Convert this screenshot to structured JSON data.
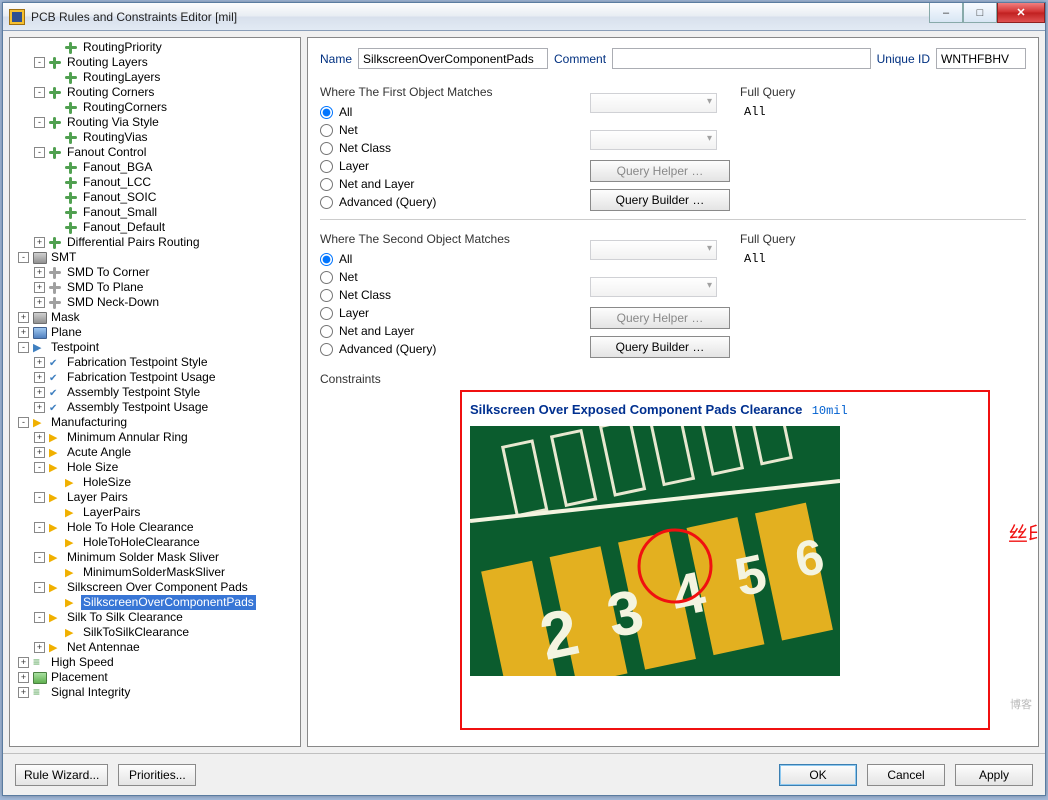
{
  "window": {
    "title": "PCB Rules and Constraints Editor [mil]"
  },
  "tree": {
    "nodes": [
      {
        "lbl": "RoutingPriority",
        "ic": "route",
        "depth": 3
      },
      {
        "lbl": "Routing Layers",
        "ic": "route",
        "depth": 2,
        "exp": "-"
      },
      {
        "lbl": "RoutingLayers",
        "ic": "route",
        "depth": 3
      },
      {
        "lbl": "Routing Corners",
        "ic": "route",
        "depth": 2,
        "exp": "-"
      },
      {
        "lbl": "RoutingCorners",
        "ic": "route",
        "depth": 3
      },
      {
        "lbl": "Routing Via Style",
        "ic": "route",
        "depth": 2,
        "exp": "-"
      },
      {
        "lbl": "RoutingVias",
        "ic": "route",
        "depth": 3
      },
      {
        "lbl": "Fanout Control",
        "ic": "route",
        "depth": 2,
        "exp": "-"
      },
      {
        "lbl": "Fanout_BGA",
        "ic": "route",
        "depth": 3
      },
      {
        "lbl": "Fanout_LCC",
        "ic": "route",
        "depth": 3
      },
      {
        "lbl": "Fanout_SOIC",
        "ic": "route",
        "depth": 3
      },
      {
        "lbl": "Fanout_Small",
        "ic": "route",
        "depth": 3
      },
      {
        "lbl": "Fanout_Default",
        "ic": "route",
        "depth": 3
      },
      {
        "lbl": "Differential Pairs Routing",
        "ic": "route",
        "depth": 2,
        "exp": "+"
      },
      {
        "lbl": "SMT",
        "ic": "cat-gray",
        "depth": 1,
        "exp": "-"
      },
      {
        "lbl": "SMD To Corner",
        "ic": "gray",
        "depth": 2,
        "exp": "+"
      },
      {
        "lbl": "SMD To Plane",
        "ic": "gray",
        "depth": 2,
        "exp": "+"
      },
      {
        "lbl": "SMD Neck-Down",
        "ic": "gray",
        "depth": 2,
        "exp": "+"
      },
      {
        "lbl": "Mask",
        "ic": "cat-gray",
        "depth": 1,
        "exp": "+"
      },
      {
        "lbl": "Plane",
        "ic": "cat-blue",
        "depth": 1,
        "exp": "+"
      },
      {
        "lbl": "Testpoint",
        "ic": "tp",
        "depth": 1,
        "exp": "-"
      },
      {
        "lbl": "Fabrication Testpoint Style",
        "ic": "tp-rule",
        "depth": 2,
        "exp": "+"
      },
      {
        "lbl": "Fabrication Testpoint Usage",
        "ic": "tp-rule",
        "depth": 2,
        "exp": "+"
      },
      {
        "lbl": "Assembly Testpoint Style",
        "ic": "tp-rule",
        "depth": 2,
        "exp": "+"
      },
      {
        "lbl": "Assembly Testpoint Usage",
        "ic": "tp-rule",
        "depth": 2,
        "exp": "+"
      },
      {
        "lbl": "Manufacturing",
        "ic": "mfg",
        "depth": 1,
        "exp": "-"
      },
      {
        "lbl": "Minimum Annular Ring",
        "ic": "mfg",
        "depth": 2,
        "exp": "+"
      },
      {
        "lbl": "Acute Angle",
        "ic": "mfg",
        "depth": 2,
        "exp": "+"
      },
      {
        "lbl": "Hole Size",
        "ic": "mfg",
        "depth": 2,
        "exp": "-"
      },
      {
        "lbl": "HoleSize",
        "ic": "mfg",
        "depth": 3
      },
      {
        "lbl": "Layer Pairs",
        "ic": "mfg",
        "depth": 2,
        "exp": "-"
      },
      {
        "lbl": "LayerPairs",
        "ic": "mfg",
        "depth": 3
      },
      {
        "lbl": "Hole To Hole Clearance",
        "ic": "mfg",
        "depth": 2,
        "exp": "-"
      },
      {
        "lbl": "HoleToHoleClearance",
        "ic": "mfg",
        "depth": 3
      },
      {
        "lbl": "Minimum Solder Mask Sliver",
        "ic": "mfg",
        "depth": 2,
        "exp": "-"
      },
      {
        "lbl": "MinimumSolderMaskSliver",
        "ic": "mfg",
        "depth": 3
      },
      {
        "lbl": "Silkscreen Over Component Pads",
        "ic": "mfg",
        "depth": 2,
        "exp": "-"
      },
      {
        "lbl": "SilkscreenOverComponentPads",
        "ic": "mfg",
        "depth": 3,
        "sel": true
      },
      {
        "lbl": "Silk To Silk Clearance",
        "ic": "mfg",
        "depth": 2,
        "exp": "-"
      },
      {
        "lbl": "SilkToSilkClearance",
        "ic": "mfg",
        "depth": 3
      },
      {
        "lbl": "Net Antennae",
        "ic": "mfg",
        "depth": 2,
        "exp": "+"
      },
      {
        "lbl": "High Speed",
        "ic": "hs",
        "depth": 1,
        "exp": "+"
      },
      {
        "lbl": "Placement",
        "ic": "cat",
        "depth": 1,
        "exp": "+"
      },
      {
        "lbl": "Signal Integrity",
        "ic": "hs",
        "depth": 1,
        "exp": "+"
      }
    ]
  },
  "form": {
    "name_label": "Name",
    "name_value": "SilkscreenOverComponentPads",
    "comment_label": "Comment",
    "comment_value": "",
    "uniqueid_label": "Unique ID",
    "uniqueid_value": "WNTHFBHV"
  },
  "match": {
    "first_title": "Where The First Object Matches",
    "second_title": "Where The Second Object Matches",
    "options": [
      "All",
      "Net",
      "Net Class",
      "Layer",
      "Net and Layer",
      "Advanced (Query)"
    ],
    "selected": "All",
    "query_helper": "Query Helper …",
    "query_builder": "Query Builder …",
    "full_query_label": "Full Query",
    "full_query_value": "All"
  },
  "constraints": {
    "section_label": "Constraints",
    "title": "Silkscreen Over Exposed Component Pads Clearance",
    "value": "10mil",
    "annotation": "丝印层的字覆盖焊盘",
    "img_numbers": [
      "2",
      "3",
      "4",
      "5",
      "6"
    ]
  },
  "footer": {
    "rule_wizard": "Rule Wizard...",
    "priorities": "Priorities...",
    "ok": "OK",
    "cancel": "Cancel",
    "apply": "Apply"
  },
  "watermark": "博客"
}
